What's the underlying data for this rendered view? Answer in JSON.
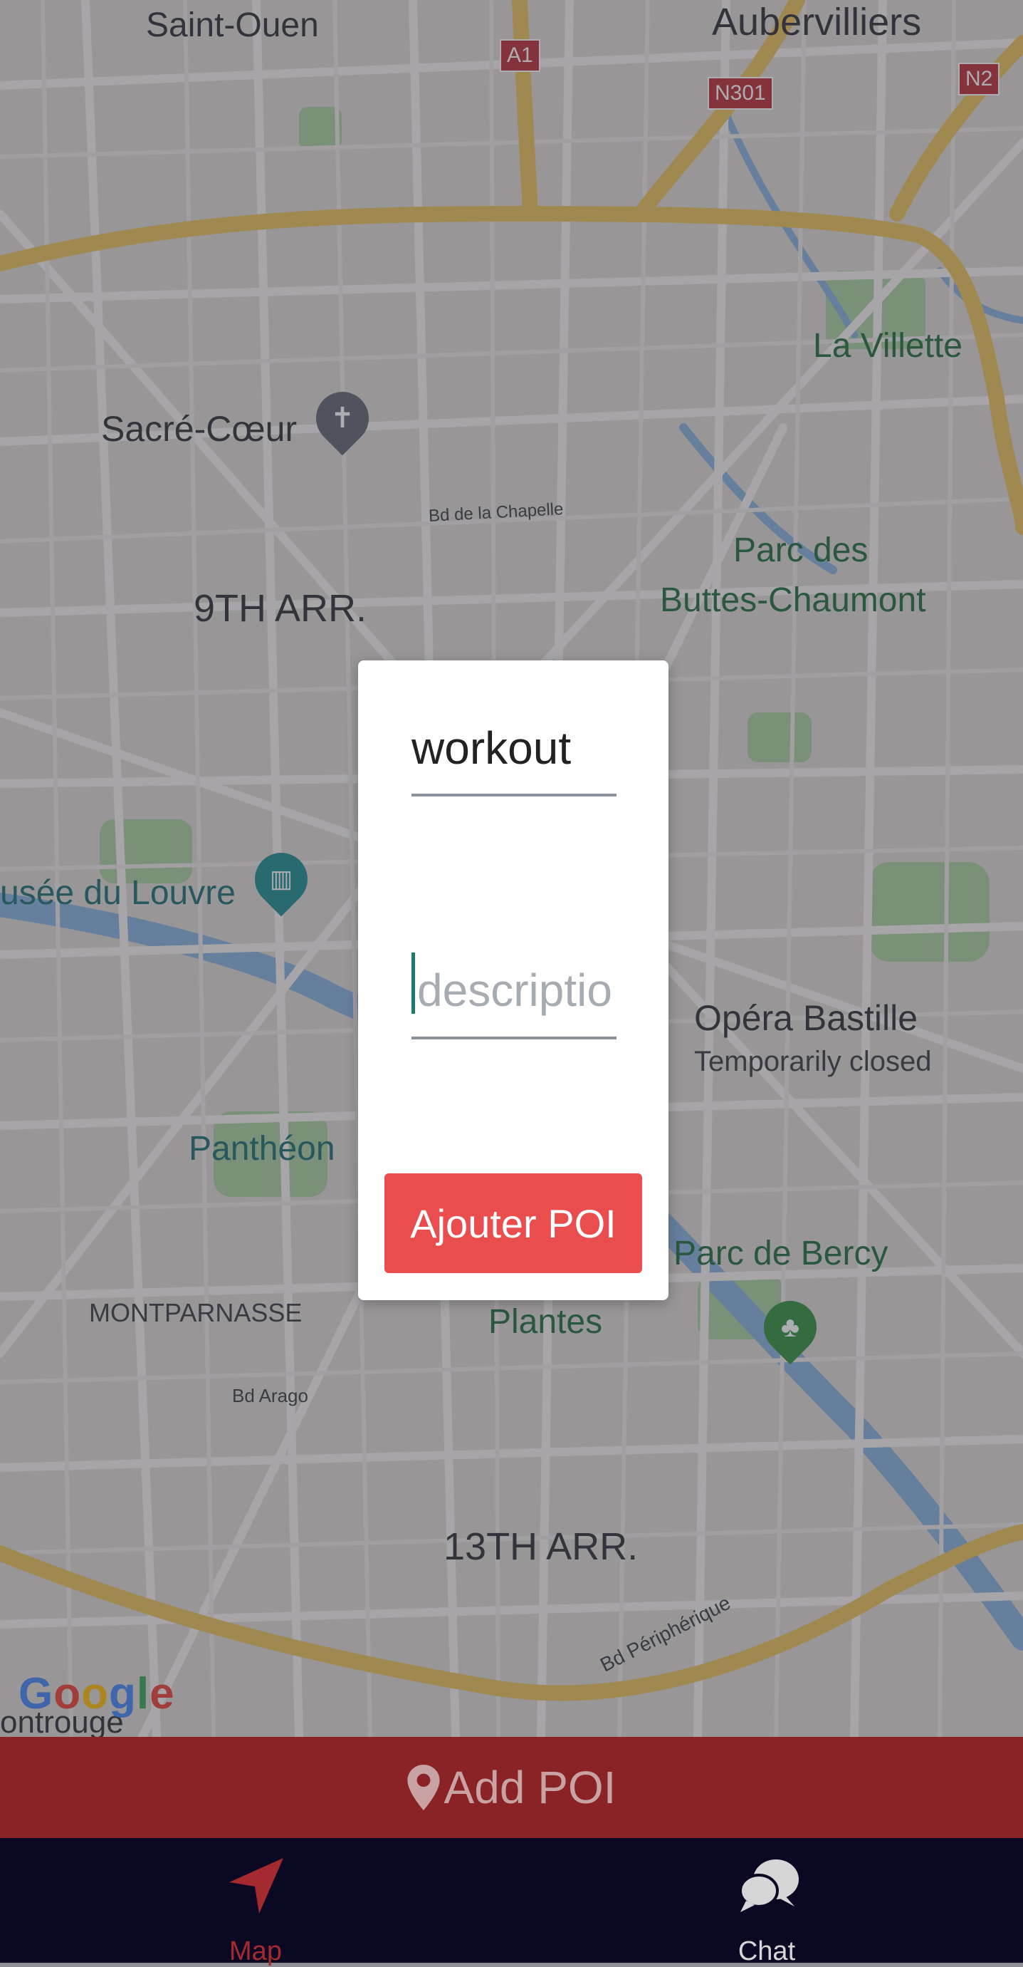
{
  "map": {
    "labels": {
      "saint_ouen": "Saint-Ouen",
      "aubervilliers": "Aubervilliers",
      "la_villette": "La Villette",
      "sacre_coeur": "Sacré-Cœur",
      "bd_chapelle": "Bd de la Chapelle",
      "parc_buttes_line1": "Parc des",
      "parc_buttes_line2": "Buttes-Chaumont",
      "arr9": "9TH ARR.",
      "louvre": "usée du Louvre",
      "opera_bastille": "Opéra Bastille",
      "opera_status": "Temporarily closed",
      "pantheon": "Panthéon",
      "parc_bercy": "Parc de Bercy",
      "plantes": "Plantes",
      "montparnasse": "MONTPARNASSE",
      "bd_arago": "Bd Arago",
      "arr13": "13TH ARR.",
      "bd_peripherique": "Bd Périphérique",
      "montrouge": "ontrouge"
    },
    "shields": {
      "a1": "A1",
      "n301": "N301",
      "n2": "N2"
    },
    "google_logo": "Google",
    "colors": {
      "land": "#d9d7d2",
      "water": "#7fa9d8",
      "park": "#9fc89a",
      "highway": "#e6c45c"
    }
  },
  "dialog": {
    "title_value": "workout",
    "description_placeholder": "descriptio",
    "add_button_label": "Ajouter POI",
    "accent_color": "#ea4d4d"
  },
  "add_poi_bar": {
    "label": "Add POI",
    "icon": "map-pin-icon",
    "color": "#8a2326"
  },
  "tabs": [
    {
      "label": "Map",
      "icon": "navigation-arrow-icon",
      "active": true,
      "color": "#a42a30"
    },
    {
      "label": "Chat",
      "icon": "chat-bubbles-icon",
      "active": false,
      "color": "#d6d6d6"
    }
  ]
}
